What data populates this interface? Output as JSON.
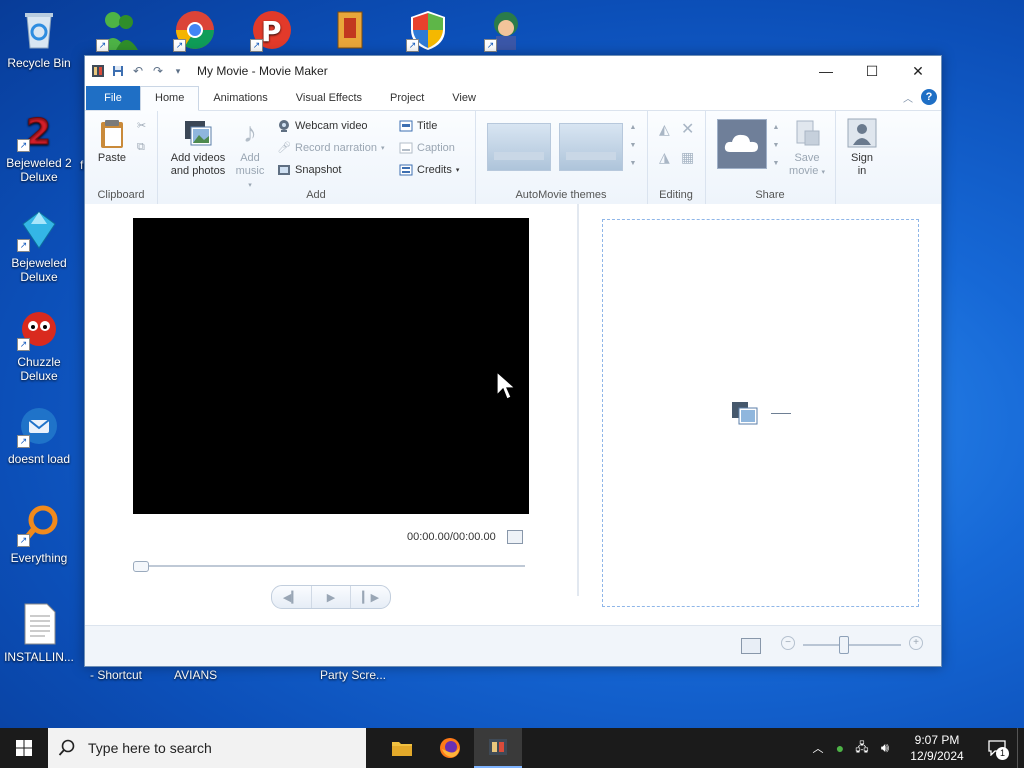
{
  "desktop": {
    "icons": [
      {
        "label": "Recycle Bin"
      },
      {
        "label": "Bejeweled 2 Deluxe"
      },
      {
        "label": "Bejeweled Deluxe"
      },
      {
        "label": "Chuzzle Deluxe"
      },
      {
        "label": "doesnt load"
      },
      {
        "label": "Everything"
      },
      {
        "label": "INSTALLIN..."
      }
    ],
    "behind_labels": [
      "- Shortcut",
      "AVIANS",
      "Party Scre...",
      "fi"
    ]
  },
  "window": {
    "title": "My Movie - Movie Maker",
    "tabs": [
      "File",
      "Home",
      "Animations",
      "Visual Effects",
      "Project",
      "View"
    ],
    "active_tab": "Home",
    "ribbon": {
      "clipboard": {
        "label": "Clipboard",
        "paste": "Paste"
      },
      "add": {
        "label": "Add",
        "add_videos_line1": "Add videos",
        "add_videos_line2": "and photos",
        "add_music_line1": "Add",
        "add_music_line2": "music",
        "webcam": "Webcam video",
        "record": "Record narration",
        "snapshot": "Snapshot",
        "title": "Title",
        "caption": "Caption",
        "credits": "Credits"
      },
      "themes": {
        "label": "AutoMovie themes"
      },
      "editing": {
        "label": "Editing"
      },
      "share": {
        "label": "Share",
        "save_line1": "Save",
        "save_line2": "movie",
        "sign_line1": "Sign",
        "sign_line2": "in"
      }
    },
    "preview": {
      "timecode": "00:00.00/00:00.00"
    }
  },
  "taskbar": {
    "search_placeholder": "Type here to search",
    "time": "9:07 PM",
    "date": "12/9/2024",
    "notification_count": "1"
  },
  "colors": {
    "file_tab": "#1f6fc5",
    "desktop_blue": "#1668d6"
  }
}
